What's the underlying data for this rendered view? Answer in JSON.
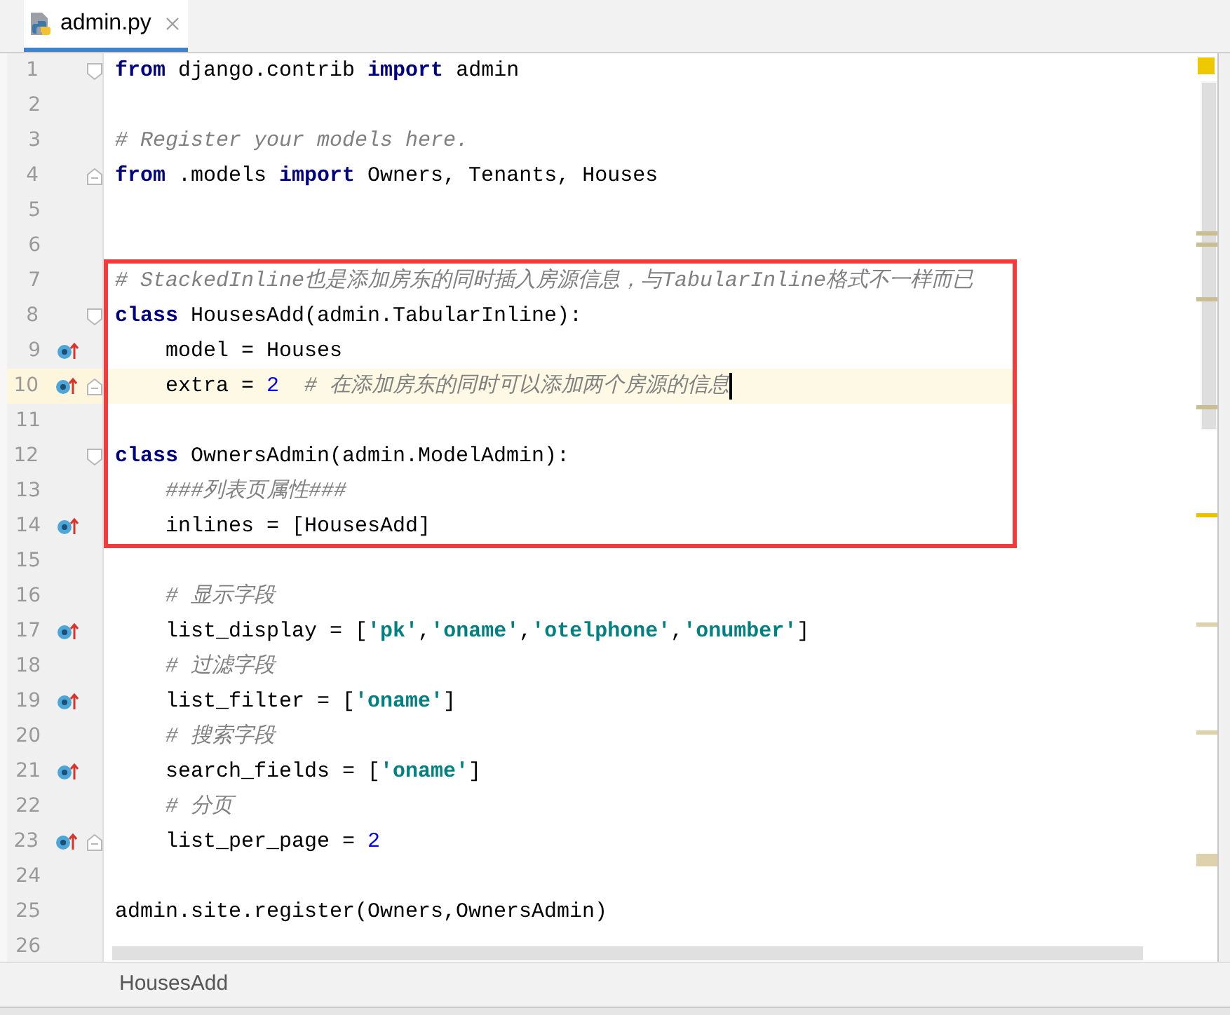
{
  "tabs": [
    {
      "label": "admin.py",
      "selected": true,
      "closable": true
    }
  ],
  "segments": [
    {
      "boxed": false,
      "lines": [
        {
          "number": "1",
          "fold_start": true,
          "tokens": [
            {
              "kind": "keyword",
              "text": "from"
            },
            {
              "kind": "plain",
              "text": " django.contrib "
            },
            {
              "kind": "keyword",
              "text": "import"
            },
            {
              "kind": "plain",
              "text": " admin"
            }
          ]
        },
        {
          "number": "2"
        },
        {
          "number": "3",
          "tokens": [
            {
              "kind": "comment",
              "text": "# Register your models here."
            }
          ]
        },
        {
          "number": "4",
          "fold_end": true,
          "tokens": [
            {
              "kind": "keyword",
              "text": "from"
            },
            {
              "kind": "plain",
              "text": " .models "
            },
            {
              "kind": "keyword",
              "text": "import"
            },
            {
              "kind": "plain",
              "text": " Owners, Tenants, Houses"
            }
          ]
        },
        {
          "number": "5"
        },
        {
          "number": "6"
        }
      ]
    },
    {
      "boxed": true,
      "lines": [
        {
          "number": "7",
          "tokens": [
            {
              "kind": "comment",
              "text": "# StackedInline也是添加房东的同时插入房源信息，与TabularInline格式不一样而已"
            }
          ]
        },
        {
          "number": "8",
          "fold_start": true,
          "tokens": [
            {
              "kind": "keyword",
              "text": "class"
            },
            {
              "kind": "plain",
              "text": " HousesAdd(admin.TabularInline):"
            }
          ]
        },
        {
          "number": "9",
          "override": true,
          "indent": true,
          "tokens": [
            {
              "kind": "plain",
              "text": "model = Houses"
            }
          ]
        },
        {
          "number": "10",
          "override": true,
          "fold_end": true,
          "current": true,
          "caret": true,
          "indent": true,
          "tokens": [
            {
              "kind": "plain",
              "text": "extra = "
            },
            {
              "kind": "number",
              "text": "2"
            },
            {
              "kind": "comment",
              "text": "# 在添加房东的同时可以添加两个房源的信息",
              "spaced": true
            }
          ]
        },
        {
          "number": "11"
        },
        {
          "number": "12",
          "fold_start": true,
          "tokens": [
            {
              "kind": "keyword",
              "text": "class"
            },
            {
              "kind": "plain",
              "text": " OwnersAdmin(admin.ModelAdmin):"
            }
          ]
        },
        {
          "number": "13",
          "indent": true,
          "tokens": [
            {
              "kind": "comment",
              "text": "###列表页属性###"
            }
          ]
        },
        {
          "number": "14",
          "override": true,
          "indent": true,
          "tokens": [
            {
              "kind": "plain",
              "text": "inlines = [HousesAdd]"
            }
          ]
        }
      ]
    },
    {
      "boxed": false,
      "lines": [
        {
          "number": "15"
        },
        {
          "number": "16",
          "indent": true,
          "tokens": [
            {
              "kind": "comment",
              "text": "# 显示字段"
            }
          ]
        },
        {
          "number": "17",
          "override": true,
          "indent": true,
          "tokens": [
            {
              "kind": "plain",
              "text": "list_display = ["
            },
            {
              "kind": "string",
              "text": "'pk'"
            },
            {
              "kind": "plain",
              "text": ","
            },
            {
              "kind": "string",
              "text": "'oname'"
            },
            {
              "kind": "plain",
              "text": ","
            },
            {
              "kind": "string",
              "text": "'otelphone'"
            },
            {
              "kind": "plain",
              "text": ","
            },
            {
              "kind": "string",
              "text": "'onumber'"
            },
            {
              "kind": "plain",
              "text": "]"
            }
          ]
        },
        {
          "number": "18",
          "indent": true,
          "tokens": [
            {
              "kind": "comment",
              "text": "# 过滤字段"
            }
          ]
        },
        {
          "number": "19",
          "override": true,
          "indent": true,
          "tokens": [
            {
              "kind": "plain",
              "text": "list_filter = ["
            },
            {
              "kind": "string",
              "text": "'oname'"
            },
            {
              "kind": "plain",
              "text": "]"
            }
          ]
        },
        {
          "number": "20",
          "indent": true,
          "tokens": [
            {
              "kind": "comment",
              "text": "# 搜索字段"
            }
          ]
        },
        {
          "number": "21",
          "override": true,
          "indent": true,
          "tokens": [
            {
              "kind": "plain",
              "text": "search_fields = ["
            },
            {
              "kind": "string",
              "text": "'oname'"
            },
            {
              "kind": "plain",
              "text": "]"
            }
          ]
        },
        {
          "number": "22",
          "indent": true,
          "tokens": [
            {
              "kind": "comment",
              "text": "# 分页"
            }
          ]
        },
        {
          "number": "23",
          "override": true,
          "fold_end": true,
          "indent": true,
          "tokens": [
            {
              "kind": "plain",
              "text": "list_per_page = "
            },
            {
              "kind": "number",
              "text": "2"
            }
          ]
        },
        {
          "number": "24"
        },
        {
          "number": "25",
          "tokens": [
            {
              "kind": "plain",
              "text": "admin.site.register(Owners,OwnersAdmin)"
            }
          ]
        },
        {
          "number": "26"
        }
      ]
    }
  ],
  "breadcrumb": "HousesAdd"
}
